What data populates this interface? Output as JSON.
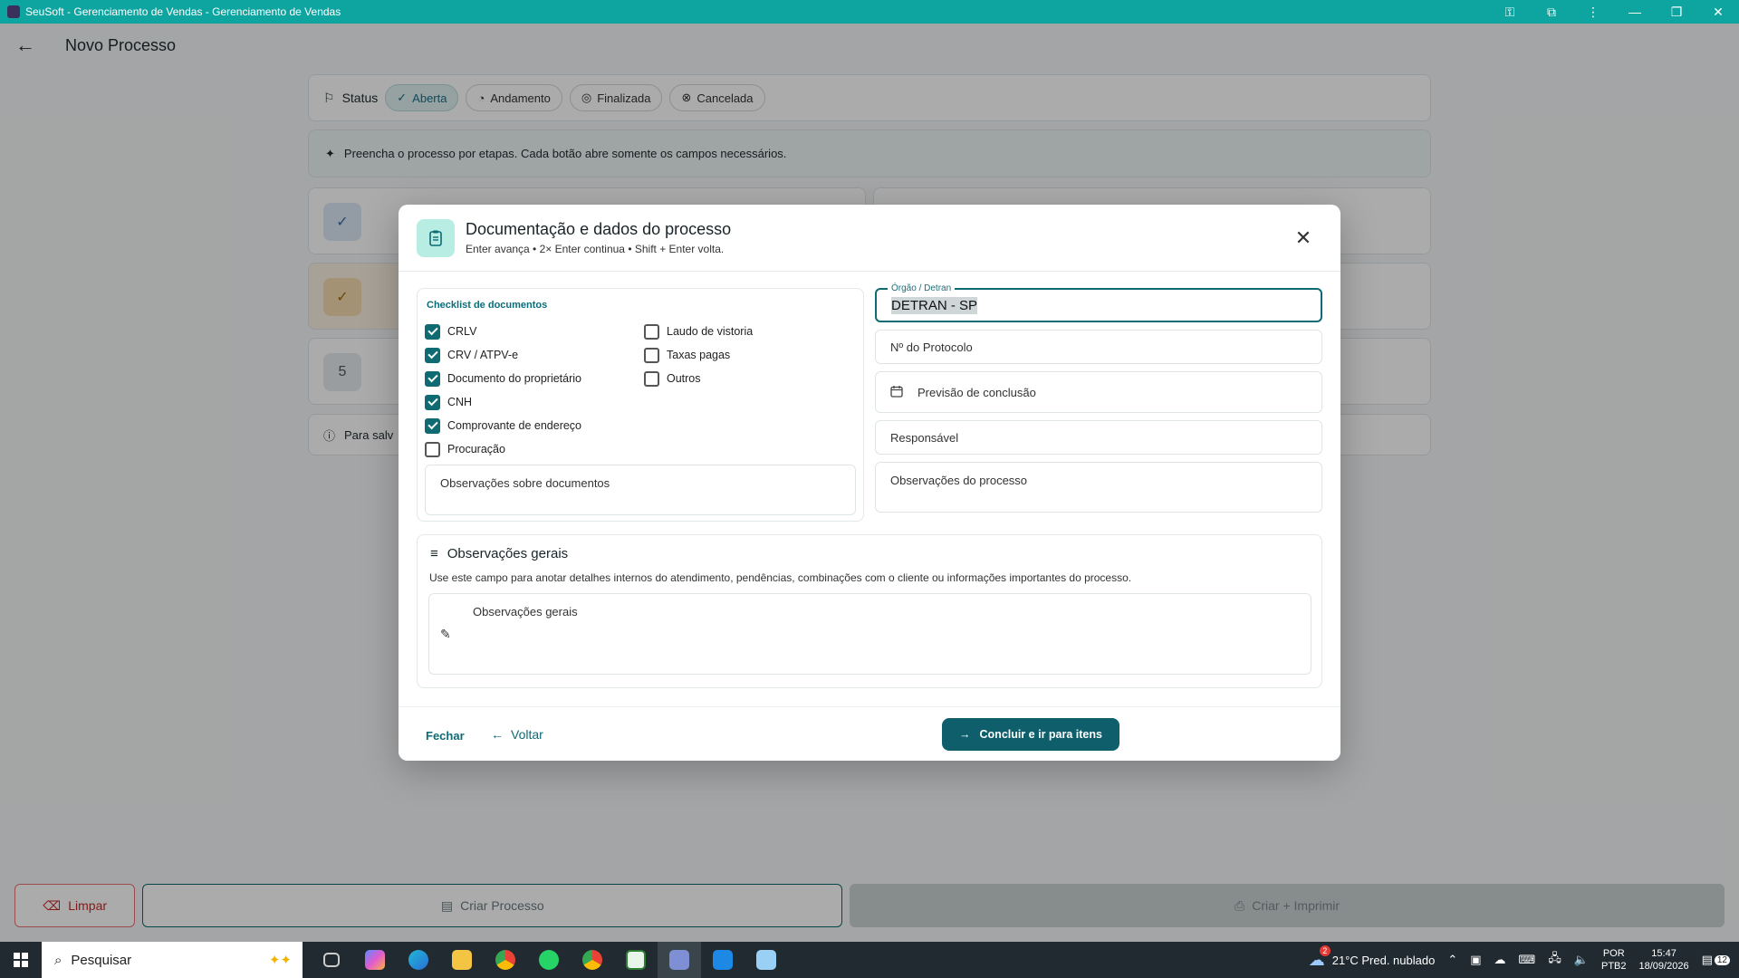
{
  "window": {
    "title": "SeuSoft - Gerenciamento de Vendas - Gerenciamento de Vendas"
  },
  "appbar": {
    "title": "Novo Processo"
  },
  "status_bar": {
    "label": "Status",
    "chips": [
      {
        "label": "Aberta",
        "active": true
      },
      {
        "label": "Andamento",
        "active": false
      },
      {
        "label": "Finalizada",
        "active": false
      },
      {
        "label": "Cancelada",
        "active": false
      }
    ]
  },
  "hint": {
    "text": "Preencha o processo por etapas. Cada botão abre somente os campos necessários."
  },
  "steps": {
    "step5_number": "5"
  },
  "info_bar": {
    "text": "Para salv"
  },
  "bottom_bar": {
    "limpar": "Limpar",
    "criar": "Criar Processo",
    "imprimir": "Criar + Imprimir"
  },
  "dialog": {
    "title": "Documentação e dados do processo",
    "subtitle": "Enter avança • 2× Enter continua • Shift + Enter volta.",
    "checklist": {
      "title": "Checklist de documentos",
      "left": [
        {
          "label": "CRLV",
          "checked": true
        },
        {
          "label": "CRV / ATPV-e",
          "checked": true
        },
        {
          "label": "Documento do proprietário",
          "checked": true
        },
        {
          "label": "CNH",
          "checked": true
        },
        {
          "label": "Comprovante de endereço",
          "checked": true
        },
        {
          "label": "Procuração",
          "checked": false
        }
      ],
      "right": [
        {
          "label": "Laudo de vistoria",
          "checked": false
        },
        {
          "label": "Taxas pagas",
          "checked": false
        },
        {
          "label": "Outros",
          "checked": false
        }
      ],
      "obs_placeholder": "Observações sobre documentos"
    },
    "fields": {
      "orgao_label": "Órgão / Detran",
      "orgao_value": "DETRAN - SP",
      "protocolo": "Nº do Protocolo",
      "previsao": "Previsão de conclusão",
      "responsavel": "Responsável",
      "obs_processo": "Observações do processo"
    },
    "general": {
      "title": "Observações gerais",
      "description": "Use este campo para anotar detalhes internos do atendimento, pendências, combinações com o cliente ou informações importantes do processo.",
      "field_label": "Observações gerais"
    },
    "footer": {
      "fechar": "Fechar",
      "voltar": "Voltar",
      "concluir": "Concluir e ir para itens"
    }
  },
  "taskbar": {
    "search_placeholder": "Pesquisar",
    "weather": "21°C  Pred. nublado",
    "weather_badge": "2",
    "lang_top": "POR",
    "lang_bottom": "PTB2",
    "time": "15:47",
    "date": "18/09/2026",
    "notif_count": "12"
  }
}
